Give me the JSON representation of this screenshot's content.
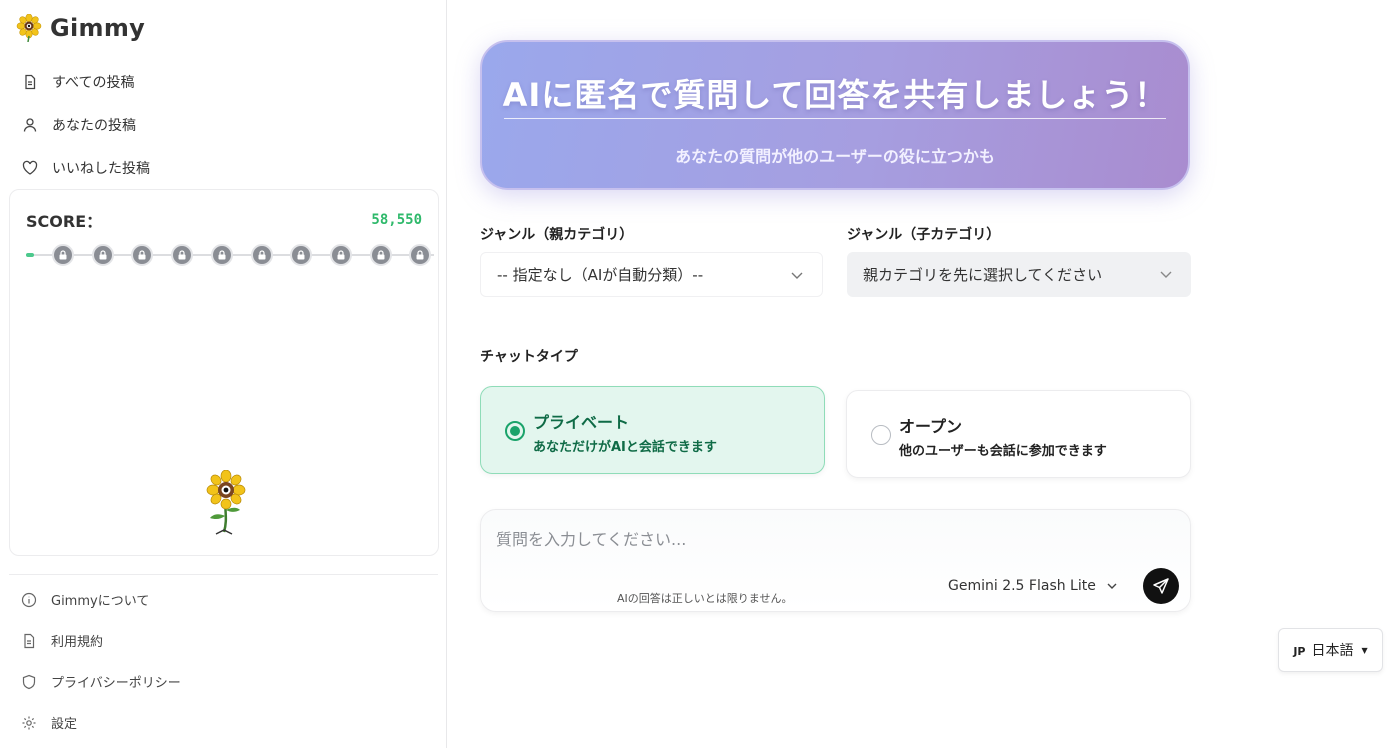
{
  "app": {
    "name": "Gimmy",
    "logo_icon": "sunflower-icon"
  },
  "sidebar": {
    "nav": [
      {
        "label": "すべての投稿",
        "icon": "document-icon"
      },
      {
        "label": "あなたの投稿",
        "icon": "user-icon"
      },
      {
        "label": "いいねした投稿",
        "icon": "heart-icon"
      }
    ],
    "score": {
      "label": "SCORE：",
      "value": "58,550",
      "progress_fraction": 0.02,
      "locked_milestones": 10,
      "mascot_icon": "sunflower-mascot-icon"
    },
    "footer": [
      {
        "label": "Gimmyについて",
        "icon": "info-icon"
      },
      {
        "label": "利用規約",
        "icon": "document-icon"
      },
      {
        "label": "プライバシーポリシー",
        "icon": "shield-icon"
      },
      {
        "label": "設定",
        "icon": "gear-icon"
      }
    ]
  },
  "hero": {
    "title": "AIに匿名で質問して回答を共有しましょう！",
    "subtitle": "あなたの質問が他のユーザーの役に立つかも"
  },
  "genre": {
    "parent_label": "ジャンル（親カテゴリ）",
    "parent_value": "-- 指定なし（AIが自動分類）--",
    "child_label": "ジャンル（子カテゴリ）",
    "child_value": "親カテゴリを先に選択してください"
  },
  "chat_type": {
    "label": "チャットタイプ",
    "options": [
      {
        "title": "プライベート",
        "desc": "あなただけがAIと会話できます",
        "selected": true
      },
      {
        "title": "オープン",
        "desc": "他のユーザーも会話に参加できます",
        "selected": false
      }
    ]
  },
  "composer": {
    "placeholder": "質問を入力してください...",
    "disclaimer": "AIの回答は正しいとは限りません。",
    "model": "Gemini 2.5 Flash Lite",
    "send_icon": "send-icon"
  },
  "language": {
    "flag": "JP",
    "label": "日本語"
  },
  "colors": {
    "accent_green": "#1aa36a",
    "score_green": "#2fb96b",
    "hero_start": "#9aa8ec",
    "hero_end": "#a98ccf"
  }
}
